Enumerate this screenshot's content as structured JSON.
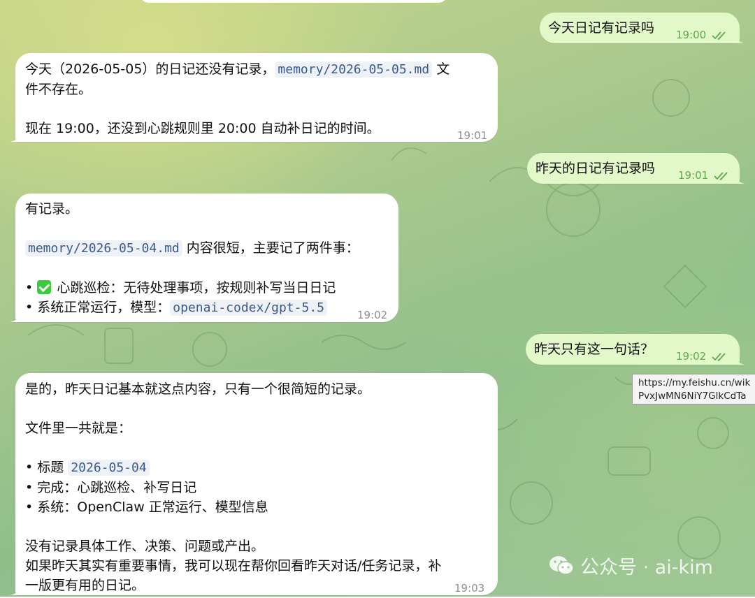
{
  "messages": [
    {
      "id": "out1",
      "direction": "outgoing",
      "text": "今天日记有记录吗",
      "time": "19:00"
    },
    {
      "id": "in1",
      "direction": "incoming",
      "line1_a": "今天（2026-05-05）的日记还没有记录，",
      "line1_code": "memory/2026-05-05.md",
      "line1_b": " 文",
      "line2": "件不存在。",
      "line4": "现在 19:00，还没到心跳规则里 20:00 自动补日记的时间。",
      "time": "19:01"
    },
    {
      "id": "out2",
      "direction": "outgoing",
      "text": "昨天的日记有记录吗",
      "time": "19:01"
    },
    {
      "id": "in2",
      "direction": "incoming",
      "line1": "有记录。",
      "line3_code": "memory/2026-05-04.md",
      "line3_b": " 内容很短，主要记了两件事：",
      "bullet1": "心跳巡检：无待处理事项，按规则补写当日日记",
      "bullet2_a": "系统正常运行，模型：",
      "bullet2_code": "openai-codex/gpt-5.5",
      "time": "19:02"
    },
    {
      "id": "out3",
      "direction": "outgoing",
      "text": "昨天只有这一句话？",
      "time": "19:02"
    },
    {
      "id": "in3",
      "direction": "incoming",
      "line1": "是的，昨天日记基本就这点内容，只有一个很简短的记录。",
      "line3": "文件里一共就是：",
      "bullet1_a": "标题 ",
      "bullet1_code": "2026-05-04",
      "bullet2": "完成：心跳巡检、补写日记",
      "bullet3": "系统：OpenClaw 正常运行、模型信息",
      "line9": "没有记录具体工作、决策、问题或产出。",
      "line10": "如果昨天其实有重要事情，我可以现在帮你回看昨天对话/任务记录，补",
      "line11": "一版更有用的日记。",
      "time": "19:03"
    }
  ],
  "bullet_char": "•",
  "tooltip": {
    "line1": "https://my.feishu.cn/wik",
    "line2": "PvxJwMN6NiY7GlkCdTa"
  },
  "watermark": {
    "text": "公众号 · ai-kim"
  },
  "colors": {
    "outgoing_bubble": "#e3f8c9",
    "incoming_bubble": "#ffffff",
    "outgoing_time": "#5fa84f",
    "code_text": "#3a5a8c"
  }
}
